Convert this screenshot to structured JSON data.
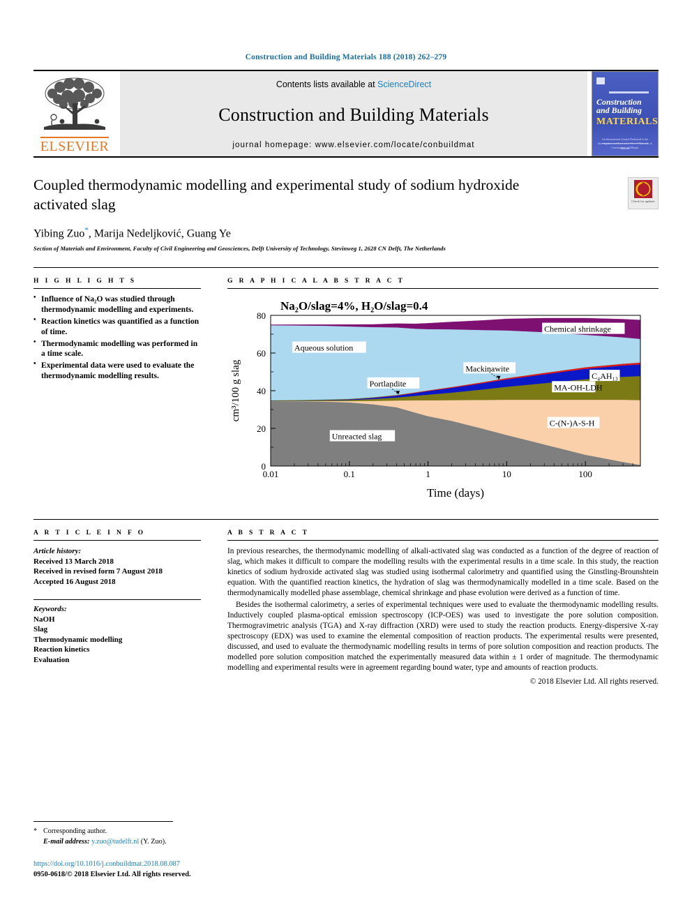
{
  "running_head": "Construction and Building Materials 188 (2018) 262–279",
  "journal_header": {
    "contents_prefix": "Contents lists available at ",
    "sciencedirect": "ScienceDirect",
    "journal_title": "Construction and Building Materials",
    "homepage": "journal homepage: www.elsevier.com/locate/conbuildmat",
    "publisher": "ELSEVIER",
    "cover": {
      "line1": "Construction",
      "line2": "and Building",
      "line3": "MATERIALS",
      "blurb": "An International Journal Dedicated to the Investigation and Innovative Use of Materials in Construction and Repair",
      "foot": "Elsevier"
    }
  },
  "article": {
    "title": "Coupled thermodynamic modelling and experimental study of sodium hydroxide activated slag",
    "authors": "Yibing Zuo",
    "author_star": "*",
    "authors_rest": ", Marija Nedeljković, Guang Ye",
    "affiliation": "Section of Materials and Environment, Faculty of Civil Engineering and Geosciences, Delft University of Technology, Stevinweg 1, 2628 CN Delft, The Netherlands",
    "crossmark_label": "Check for updates"
  },
  "highlights": {
    "heading": "H I G H L I G H T S",
    "items": [
      "Influence of Na₂O was studied through thermodynamic modelling and experiments.",
      "Reaction kinetics was quantified as a function of time.",
      "Thermodynamic modelling was performed in a time scale.",
      "Experimental data were used to evaluate the thermodynamic modelling results."
    ]
  },
  "graphical_abstract": {
    "heading": "G R A P H I C A L   A B S T R A C T"
  },
  "article_info": {
    "heading": "A R T I C L E   I N F O",
    "history_label": "Article history:",
    "received": "Received 13 March 2018",
    "revised": "Received in revised form 7 August 2018",
    "accepted": "Accepted 16 August 2018",
    "keywords_label": "Keywords:",
    "keywords": [
      "NaOH",
      "Slag",
      "Thermodynamic modelling",
      "Reaction kinetics",
      "Evaluation"
    ]
  },
  "abstract": {
    "heading": "A B S T R A C T",
    "paragraphs": [
      "In previous researches, the thermodynamic modelling of alkali-activated slag was conducted as a function of the degree of reaction of slag, which makes it difficult to compare the modelling results with the experimental results in a time scale. In this study, the reaction kinetics of sodium hydroxide activated slag was studied using isothermal calorimetry and quantified using the Ginstling-Brounshtein equation. With the quantified reaction kinetics, the hydration of slag was thermodynamically modelled in a time scale. Based on the thermodynamically modelled phase assemblage, chemical shrinkage and phase evolution were derived as a function of time.",
      "Besides the isothermal calorimetry, a series of experimental techniques were used to evaluate the thermodynamic modelling results. Inductively coupled plasma-optical emission spectroscopy (ICP-OES) was used to investigate the pore solution composition. Thermogravimetric analysis (TGA) and X-ray diffraction (XRD) were used to study the reaction products. Energy-dispersive X-ray spectroscopy (EDX) was used to examine the elemental composition of reaction products. The experimental results were presented, discussed, and used to evaluate the thermodynamic modelling results in terms of pore solution composition and reaction products. The modelled pore solution composition matched the experimentally measured data within ± 1 order of magnitude. The thermodynamic modelling and experimental results were in agreement regarding bound water, type and amounts of reaction products."
    ],
    "copyright": "© 2018 Elsevier Ltd. All rights reserved."
  },
  "footer": {
    "corresponding": "Corresponding author.",
    "email_label": "E-mail address:",
    "email": "y.zuo@tudelft.nl",
    "email_suffix": "(Y. Zuo).",
    "doi": "https://doi.org/10.1016/j.conbuildmat.2018.08.087",
    "issn": "0950-0618/© 2018 Elsevier Ltd. All rights reserved."
  },
  "chart_data": {
    "type": "area",
    "title": "Na₂O/slag=4%, H₂O/slag=0.4",
    "xlabel": "Time (days)",
    "ylabel": "cm³/100 g slag",
    "xscale": "log",
    "xlim": [
      0.01,
      500
    ],
    "ylim": [
      0,
      80
    ],
    "xticks": [
      "0.01",
      "0.1",
      "1",
      "10",
      "100"
    ],
    "yticks": [
      "0",
      "20",
      "40",
      "60",
      "80"
    ],
    "grid": false,
    "x": [
      0.01,
      0.02,
      0.05,
      0.1,
      0.2,
      0.4,
      0.7,
      1,
      2,
      5,
      10,
      30,
      100,
      300,
      500
    ],
    "series": [
      {
        "name": "Unreacted slag",
        "color": "#7f7f7f",
        "values": [
          34.5,
          34.4,
          34.2,
          33.8,
          32.8,
          31.2,
          28.3,
          26.5,
          24.0,
          19.8,
          16.5,
          11.5,
          6.0,
          2.2,
          0.6
        ]
      },
      {
        "name": "C-(N-)A-S-H",
        "color": "#fad0ab",
        "values": [
          0.0,
          0.1,
          0.3,
          0.7,
          1.8,
          3.6,
          6.6,
          8.4,
          11.0,
          15.3,
          18.7,
          23.7,
          29.2,
          33.0,
          34.4
        ]
      },
      {
        "name": "MA-OH-LDH",
        "color": "#7b7a15",
        "values": [
          0.1,
          0.2,
          0.4,
          0.6,
          1.0,
          1.6,
          2.4,
          3.0,
          4.0,
          5.6,
          6.9,
          8.8,
          10.9,
          12.2,
          12.8
        ]
      },
      {
        "name": "C₄AH₁₃",
        "color": "#0a18c8",
        "values": [
          0.1,
          0.1,
          0.2,
          0.3,
          0.6,
          1.0,
          1.5,
          1.9,
          2.5,
          3.3,
          3.9,
          4.7,
          5.5,
          6.0,
          6.2
        ]
      },
      {
        "name": "Mackinawite",
        "color": "#e01b1b",
        "values": [
          0.05,
          0.06,
          0.08,
          0.12,
          0.18,
          0.26,
          0.35,
          0.4,
          0.5,
          0.6,
          0.7,
          0.8,
          0.9,
          0.95,
          1.0
        ]
      },
      {
        "name": "Portlandite",
        "color": "#3bb54a",
        "values": [
          0.2,
          0.2,
          0.2,
          0.2,
          0.2,
          0.15,
          0.05,
          0.0,
          0.0,
          0.0,
          0.0,
          0.0,
          0.0,
          0.0,
          0.0
        ]
      },
      {
        "name": "Aqueous solution",
        "color": "#add9f0",
        "values": [
          39.8,
          39.6,
          39.1,
          38.4,
          37.2,
          35.8,
          33.7,
          32.5,
          30.6,
          27.6,
          25.3,
          21.6,
          17.2,
          14.0,
          12.5
        ]
      },
      {
        "name": "Chemical shrinkage",
        "color": "#7d1070",
        "values": [
          0.25,
          0.4,
          0.6,
          1.0,
          1.4,
          2.0,
          2.6,
          3.1,
          3.9,
          5.1,
          6.1,
          7.4,
          8.8,
          9.6,
          10.0
        ]
      }
    ],
    "annotations": [
      {
        "label": "Chemical shrinkage",
        "x": 30,
        "y": 72
      },
      {
        "label": "Aqueous solution",
        "x": 0.02,
        "y": 62
      },
      {
        "label": "Mackinawite",
        "x": 3,
        "y": 51
      },
      {
        "label": "Portlandite",
        "x": 0.18,
        "y": 43
      },
      {
        "label": "C₄AH₁₃",
        "x": 120,
        "y": 47
      },
      {
        "label": "MA-OH-LDH",
        "x": 40,
        "y": 41
      },
      {
        "label": "C-(N-)A-S-H",
        "x": 35,
        "y": 22
      },
      {
        "label": "Unreacted slag",
        "x": 0.06,
        "y": 15
      }
    ]
  }
}
